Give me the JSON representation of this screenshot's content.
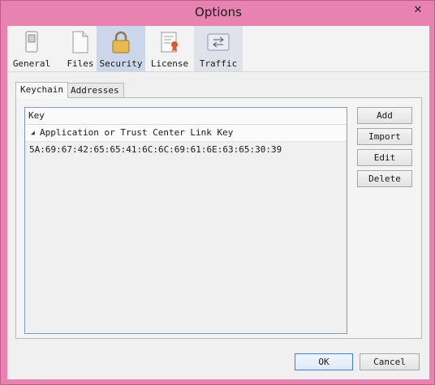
{
  "window": {
    "title": "Options",
    "close_glyph": "✕"
  },
  "toolbar": {
    "items": [
      {
        "label": "General",
        "icon": "switch-icon"
      },
      {
        "label": "Files",
        "icon": "document-icon"
      },
      {
        "label": "Security",
        "icon": "lock-icon"
      },
      {
        "label": "License",
        "icon": "certificate-icon"
      },
      {
        "label": "Traffic",
        "icon": "traffic-arrows-icon"
      }
    ],
    "selected": "Security"
  },
  "tabs": [
    {
      "label": "Keychain"
    },
    {
      "label": "Addresses"
    }
  ],
  "keychain": {
    "column_header": "Key",
    "group": {
      "expander": "◢",
      "label": "Application or Trust Center Link Key"
    },
    "rows": [
      "5A:69:67:42:65:65:41:6C:6C:69:61:6E:63:65:30:39"
    ]
  },
  "side_buttons": {
    "add": "Add",
    "import": "Import",
    "edit": "Edit",
    "delete": "Delete"
  },
  "footer": {
    "ok": "OK",
    "cancel": "Cancel"
  }
}
